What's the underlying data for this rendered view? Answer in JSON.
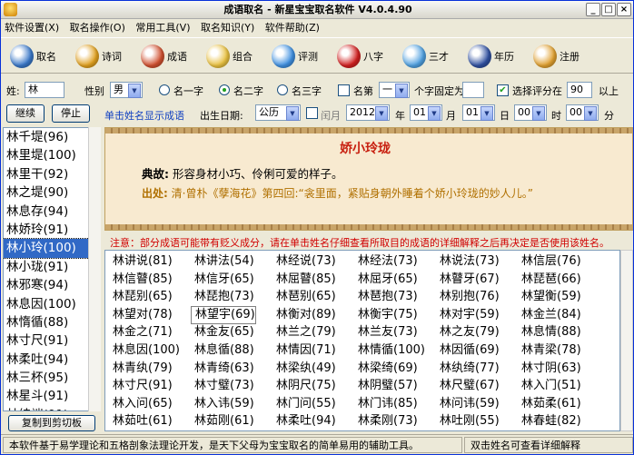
{
  "window": {
    "title": "成语取名 - 新星宝宝取名软件 V4.0.4.90"
  },
  "menu": [
    "软件设置(X)",
    "取名操作(O)",
    "常用工具(V)",
    "取名知识(Y)",
    "软件帮助(Z)"
  ],
  "toolbar": [
    {
      "label": "取名",
      "color": "#3a78c8"
    },
    {
      "label": "诗词",
      "color": "#e0a020"
    },
    {
      "label": "成语",
      "color": "#d05030"
    },
    {
      "label": "组合",
      "color": "#e8c040"
    },
    {
      "label": "评测",
      "color": "#4090e0"
    },
    {
      "label": "八字",
      "color": "#d02020"
    },
    {
      "label": "三才",
      "color": "#50a0e0"
    },
    {
      "label": "年历",
      "color": "#3050a0"
    },
    {
      "label": "注册",
      "color": "#e0a030"
    }
  ],
  "filters": {
    "surname_label": "姓:",
    "surname_value": "林",
    "gender_label": "性别",
    "gender_value": "男",
    "radio_one": "名一字",
    "radio_two": "名二字",
    "radio_three": "名三字",
    "first_char_label": "名第",
    "first_char_value": "一",
    "fixed_label": "个字固定为",
    "fixed_value": "",
    "score_label": "选择评分在",
    "score_value": "90",
    "score_suffix": "以上",
    "continue_button": "继续",
    "stop_button": "停止",
    "hint": "单击姓名显示成语",
    "birth_label": "出生日期:",
    "calendar_value": "公历",
    "leap_label": "闰月",
    "year_value": "2012",
    "year_unit": "年",
    "month_value": "01",
    "month_unit": "月",
    "day_value": "01",
    "day_unit": "日",
    "hour_value": "00",
    "hour_unit": "时",
    "minute_value": "00",
    "minute_unit": "分"
  },
  "left_list": [
    "林千堤(96)",
    "林里堤(100)",
    "林里干(92)",
    "林之堤(90)",
    "林息存(94)",
    "林娇玲(91)",
    "林小玲(100)",
    "林小珑(91)",
    "林邪寒(94)",
    "林息因(100)",
    "林惰循(88)",
    "林寸尺(91)",
    "林柔吐(94)",
    "林三杯(95)",
    "林星斗(91)",
    "林纬端(91)"
  ],
  "left_selected": 6,
  "copy_button": "复制到剪切板",
  "idiom_panel": {
    "idiom": "娇小玲珑",
    "meaning_label": "典故:",
    "meaning": "形容身材小巧、伶俐可爱的样子。",
    "source_label": "出处:",
    "source": "清·曾朴《孽海花》第四回:“衾里面，紧贴身朝外睡着个娇小玲珑的妙人儿。”"
  },
  "notice": "注意：部分成语可能带有贬义成分，请在单击姓名仔细查看所取目的成语的详细解释之后再决定是否使用该姓名。",
  "results": [
    [
      "林讲说(81)",
      "林讲法(54)",
      "林经说(73)",
      "林经法(73)",
      "林说法(73)",
      "林信层(76)"
    ],
    [
      "林信瞽(85)",
      "林信牙(65)",
      "林屈瞽(85)",
      "林屈牙(65)",
      "林瞽牙(67)",
      "林琵琶(66)"
    ],
    [
      "林琵别(65)",
      "林琵抱(73)",
      "林琶别(65)",
      "林琶抱(73)",
      "林别抱(76)",
      "林望衡(59)"
    ],
    [
      "林望对(78)",
      "林望宇(69)",
      "林衡对(89)",
      "林衡宇(75)",
      "林对宇(59)",
      "林金兰(84)"
    ],
    [
      "林金之(71)",
      "林金友(65)",
      "林兰之(79)",
      "林兰友(73)",
      "林之友(79)",
      "林息情(88)"
    ],
    [
      "林息因(100)",
      "林息循(88)",
      "林情因(71)",
      "林情循(100)",
      "林因循(69)",
      "林青梁(78)"
    ],
    [
      "林青纨(79)",
      "林青绮(63)",
      "林梁纨(49)",
      "林梁绮(69)",
      "林纨绮(77)",
      "林寸阴(63)"
    ],
    [
      "林寸尺(91)",
      "林寸璧(73)",
      "林阴尺(75)",
      "林阴璧(57)",
      "林尺璧(67)",
      "林入门(51)"
    ],
    [
      "林入问(65)",
      "林入讳(59)",
      "林门问(55)",
      "林门讳(85)",
      "林问讳(59)",
      "林茹柔(61)"
    ],
    [
      "林茹吐(61)",
      "林茹刚(61)",
      "林柔吐(94)",
      "林柔刚(73)",
      "林吐刚(55)",
      "林春蛙(82)"
    ]
  ],
  "results_focus": [
    3,
    1
  ],
  "status": {
    "left": "本软件基于易学理论和五格剖象法理论开发，是天下父母为宝宝取名的简单易用的辅助工具。",
    "right": "双击姓名可查看详细解释"
  }
}
